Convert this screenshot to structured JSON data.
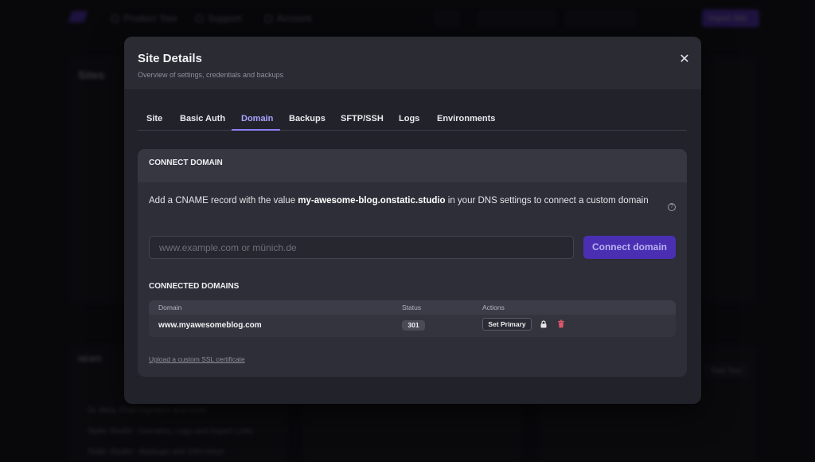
{
  "background": {
    "nav": [
      "Product Tour",
      "Support",
      "Account"
    ],
    "import_button": "Import Site",
    "sites_title": "Sites",
    "news_title": "NEWS",
    "news_items": [
      "SL Beta: Post migration and more",
      "Static Studio - Domains, Logs and Import Links",
      "Static Studio - Backups and SSH Keys"
    ],
    "tour_button": "Start Tour"
  },
  "modal": {
    "title": "Site Details",
    "subtitle": "Overview of settings, credentials and backups",
    "close_icon": "close-icon",
    "tabs": [
      {
        "label": "Site"
      },
      {
        "label": "Basic Auth"
      },
      {
        "label": "Domain"
      },
      {
        "label": "Backups"
      },
      {
        "label": "SFTP/SSH"
      },
      {
        "label": "Logs"
      },
      {
        "label": "Environments"
      }
    ],
    "active_tab": "Domain",
    "connect": {
      "heading": "CONNECT DOMAIN",
      "desc_prefix": "Add a CNAME record with the value ",
      "cname_value": "my-awesome-blog.onstatic.studio",
      "desc_suffix": " in your DNS settings to connect a custom domain",
      "input_placeholder": "www.example.com or münich.de",
      "input_value": "",
      "button": "Connect domain"
    },
    "connected": {
      "heading": "CONNECTED DOMAINS",
      "columns": [
        "Domain",
        "Status",
        "Actions"
      ],
      "rows": [
        {
          "domain": "www.myawesomeblog.com",
          "status": "301",
          "action": "Set Primary"
        }
      ]
    },
    "ssl_link": "Upload a custom SSL certificate"
  },
  "colors": {
    "accent": "#4a2fb3",
    "tab_active": "#a9a3ff",
    "trash": "#e0566b"
  }
}
